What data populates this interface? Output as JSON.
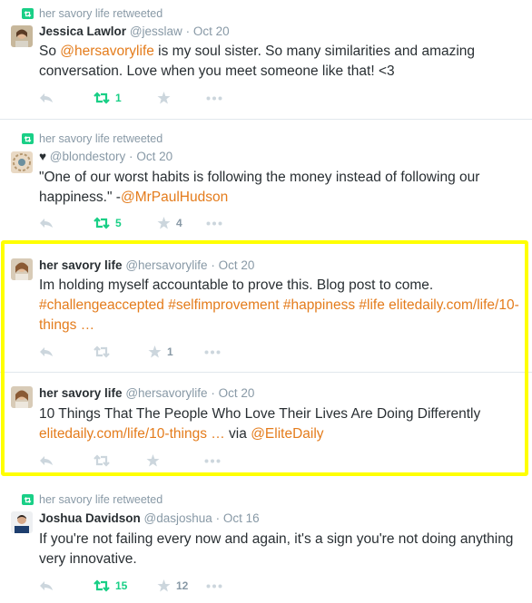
{
  "tweets": [
    {
      "retweeted_by": "her savory life retweeted",
      "name": "Jessica Lawlor",
      "handle": "@jesslaw",
      "time": "Oct 20",
      "text_parts": [
        "So ",
        "@hersavorylife",
        " is my soul sister. So many similarities and amazing conversation. Love when you meet someone like that! <3"
      ],
      "retweets": "1",
      "favorites": "",
      "retweeted": true
    },
    {
      "retweeted_by": "her savory life retweeted",
      "name": "♥",
      "handle": "@blondestory",
      "time": "Oct 20",
      "text_parts": [
        "\"One of our worst habits is following the money instead of following our happiness.\" -",
        "@MrPaulHudson"
      ],
      "retweets": "5",
      "favorites": "4",
      "retweeted": true
    },
    {
      "retweeted_by": "",
      "name": "her savory life",
      "handle": "@hersavorylife",
      "time": "Oct 20",
      "text_parts": [
        "Im holding myself accountable to prove this. Blog post to come. ",
        "#challengeaccepted #selfimprovement #happiness #life",
        " ",
        "elitedaily.com/life/10-things …"
      ],
      "retweets": "",
      "favorites": "1",
      "retweeted": false
    },
    {
      "retweeted_by": "",
      "name": "her savory life",
      "handle": "@hersavorylife",
      "time": "Oct 20",
      "text_parts": [
        "10 Things That The People Who Love Their Lives Are Doing Differently ",
        "elitedaily.com/life/10-things …",
        " via ",
        "@EliteDaily"
      ],
      "retweets": "",
      "favorites": "",
      "retweeted": false
    },
    {
      "retweeted_by": "her savory life retweeted",
      "name": "Joshua Davidson",
      "handle": "@dasjoshua",
      "time": "Oct 16",
      "text_parts": [
        "If you're not failing every now and again, it's a sign you're not doing anything very innovative."
      ],
      "retweets": "15",
      "favorites": "12",
      "retweeted": true
    }
  ],
  "header_separator": "·",
  "colors": {
    "link": "#e47c1c",
    "retweet_green": "#19cf86",
    "meta_gray": "#8899a6",
    "highlight": "#ffff00"
  },
  "icons": [
    "retweet-icon",
    "reply-icon",
    "favorite-star-icon",
    "more-dots-icon",
    "avatar"
  ]
}
